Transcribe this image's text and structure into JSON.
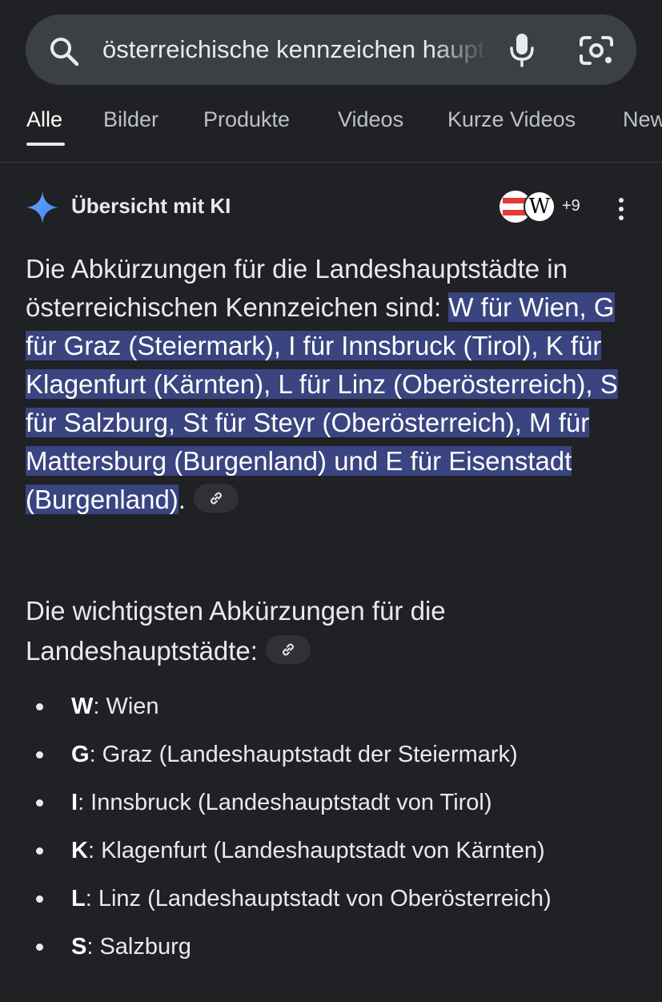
{
  "search": {
    "query": "österreichische kennzeichen hauptstädte"
  },
  "tabs": [
    {
      "label": "Alle",
      "active": true
    },
    {
      "label": "Bilder"
    },
    {
      "label": "Produkte"
    },
    {
      "label": "Videos"
    },
    {
      "label": "Kurze Videos"
    },
    {
      "label": "News"
    }
  ],
  "ai_overview": {
    "title": "Übersicht mit KI",
    "source_count": "+9",
    "source_icons": [
      "austria-flag-icon",
      "wikipedia-icon"
    ],
    "intro_plain": "Die Abkürzungen für die Landeshauptstädte in österreichischen Kennzeichen sind: ",
    "intro_highlight": "W für Wien, G für Graz (Steiermark), I für Innsbruck (Tirol), K für Klagenfurt (Kärnten), L für Linz (Oberösterreich), S für Salzburg, St für Steyr (Oberösterreich), M für Mattersburg (Burgenland) und E für Eisenstadt (Burgenland)",
    "intro_end": ".",
    "subheading": "Die wichtigsten Abkürzungen für die Landeshauptstädte:",
    "list": [
      {
        "code": "W",
        "text": ": Wien"
      },
      {
        "code": "G",
        "text": ": Graz (Landeshauptstadt der Steiermark)"
      },
      {
        "code": "I",
        "text": ": Innsbruck (Landeshauptstadt von Tirol)"
      },
      {
        "code": "K",
        "text": ": Klagenfurt (Landeshauptstadt von Kärnten)"
      },
      {
        "code": "L",
        "text": ": Linz (Landeshauptstadt von Oberösterreich)"
      },
      {
        "code": "S",
        "text": ": Salzburg"
      }
    ]
  },
  "colors": {
    "background": "#202124",
    "search_bar": "#3c4043",
    "highlight": "#394480",
    "accent_spark": "#4a8cf7"
  }
}
